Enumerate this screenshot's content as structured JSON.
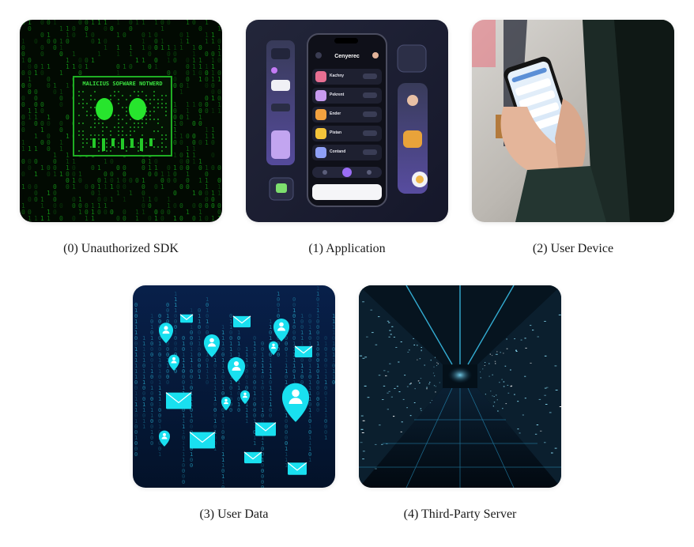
{
  "nodes": [
    {
      "caption": "(0) Unauthorized SDK",
      "image_text": "MALICIUS SOFWARE NOTWERD",
      "icon": "malware-skull-icon"
    },
    {
      "caption": "(1) Application",
      "image_text": "Cenyerec",
      "icon": "app-phone-icon"
    },
    {
      "caption": "(2) User Device",
      "icon": "smartphone-in-hands-icon"
    },
    {
      "caption": "(3) User Data",
      "icon": "data-stream-icon"
    },
    {
      "caption": "(4) Third-Party Server",
      "icon": "server-room-icon"
    }
  ],
  "app_list": [
    "Kachny",
    "Pekrent",
    "Ender",
    "Pistan",
    "Contand"
  ],
  "colors": {
    "matrix_green": "#19c21f",
    "app_purple": "#8f6bf5",
    "data_cyan": "#19e0f0",
    "server_blue": "#3fb2e6"
  }
}
